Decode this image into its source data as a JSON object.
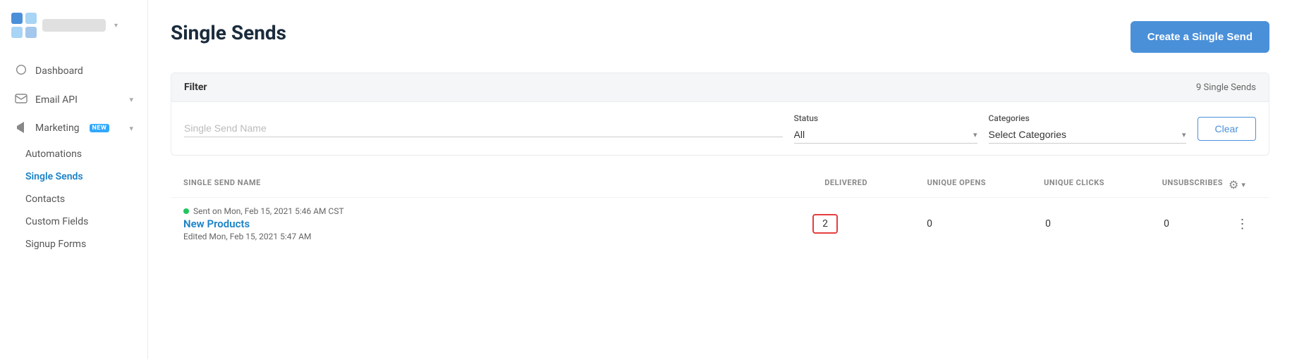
{
  "sidebar": {
    "logo_placeholder": "",
    "logo_chevron": "▾",
    "items": [
      {
        "id": "dashboard",
        "label": "Dashboard",
        "icon": "○"
      },
      {
        "id": "email-api",
        "label": "Email API",
        "icon": "▭",
        "arrow": "▾"
      },
      {
        "id": "marketing",
        "label": "Marketing",
        "icon": "📣",
        "badge": "NEW",
        "arrow": "▾"
      }
    ],
    "sub_items": [
      {
        "id": "automations",
        "label": "Automations",
        "active": false
      },
      {
        "id": "single-sends",
        "label": "Single Sends",
        "active": true
      },
      {
        "id": "contacts",
        "label": "Contacts",
        "active": false
      },
      {
        "id": "custom-fields",
        "label": "Custom Fields",
        "active": false
      },
      {
        "id": "signup-forms",
        "label": "Signup Forms",
        "active": false
      }
    ]
  },
  "page": {
    "title": "Single Sends",
    "create_button": "Create a Single Send"
  },
  "filter": {
    "title": "Filter",
    "count": "9 Single Sends",
    "name_label": "Single Send Name",
    "name_placeholder": "",
    "status_label": "Status",
    "status_value": "All",
    "categories_label": "Categories",
    "categories_placeholder": "Select Categories",
    "clear_button": "Clear"
  },
  "table": {
    "columns": [
      {
        "id": "name",
        "label": "Single Send Name"
      },
      {
        "id": "delivered",
        "label": "Delivered"
      },
      {
        "id": "unique_opens",
        "label": "Unique Opens"
      },
      {
        "id": "unique_clicks",
        "label": "Unique Clicks"
      },
      {
        "id": "unsubscribes",
        "label": "Unsubscribes"
      },
      {
        "id": "actions",
        "label": ""
      }
    ],
    "rows": [
      {
        "status_text": "Sent on Mon, Feb 15, 2021 5:46 AM CST",
        "name": "New Products",
        "edited": "Edited Mon, Feb 15, 2021 5:47 AM",
        "delivered": "2",
        "unique_opens": "0",
        "unique_clicks": "0",
        "unsubscribes": "0"
      }
    ]
  }
}
